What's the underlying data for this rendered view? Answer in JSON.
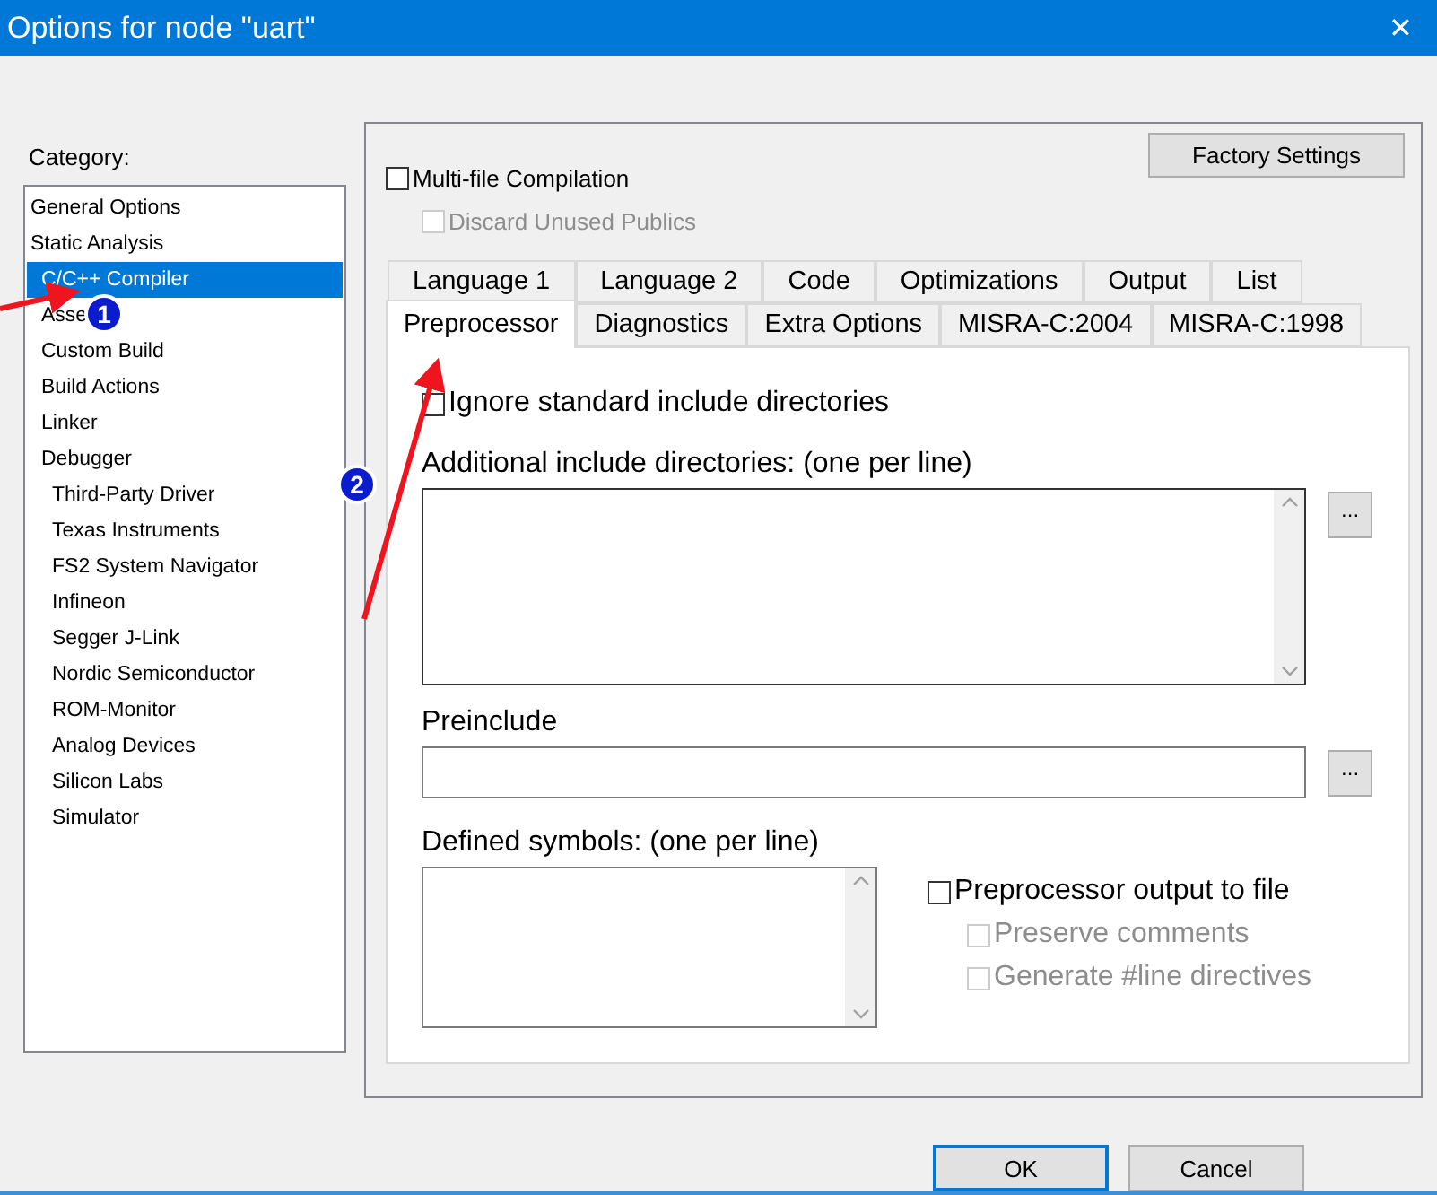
{
  "window": {
    "title": "Options for node \"uart\"",
    "close": "✕"
  },
  "category": {
    "label": "Category:",
    "items": [
      {
        "label": "General Options",
        "kind": "section",
        "selected": false
      },
      {
        "label": "Static Analysis",
        "kind": "section",
        "selected": false
      },
      {
        "label": "C/C++ Compiler",
        "kind": "tool",
        "selected": true
      },
      {
        "label": "Asse",
        "kind": "tool",
        "selected": false
      },
      {
        "label": "Custom Build",
        "kind": "tool",
        "selected": false
      },
      {
        "label": "Build Actions",
        "kind": "tool",
        "selected": false
      },
      {
        "label": "Linker",
        "kind": "tool",
        "selected": false
      },
      {
        "label": "Debugger",
        "kind": "tool",
        "selected": false,
        "children": [
          {
            "label": "Third-Party Driver",
            "kind": "tool",
            "selected": false
          },
          {
            "label": "Texas Instruments",
            "kind": "tool",
            "selected": false
          },
          {
            "label": "FS2 System Navigator",
            "kind": "tool",
            "selected": false
          },
          {
            "label": "Infineon",
            "kind": "tool",
            "selected": false
          },
          {
            "label": "Segger J-Link",
            "kind": "tool",
            "selected": false
          },
          {
            "label": "Nordic Semiconductor",
            "kind": "tool",
            "selected": false
          },
          {
            "label": "ROM-Monitor",
            "kind": "tool",
            "selected": false
          },
          {
            "label": "Analog Devices",
            "kind": "tool",
            "selected": false
          },
          {
            "label": "Silicon Labs",
            "kind": "tool",
            "selected": false
          },
          {
            "label": "Simulator",
            "kind": "tool",
            "selected": false
          }
        ]
      }
    ]
  },
  "factory_button": "Factory Settings",
  "options": [
    {
      "label": "Multi-file Compilation",
      "checked": false,
      "disabled": false
    },
    {
      "label": "Discard Unused Publics",
      "checked": false,
      "disabled": true
    }
  ],
  "tab_rows": [
    {
      "tabs": [
        {
          "label": "Language 1",
          "selected": false
        },
        {
          "label": "Language 2",
          "selected": false
        },
        {
          "label": "Code",
          "selected": false
        },
        {
          "label": "Optimizations",
          "selected": false
        },
        {
          "label": "Output",
          "selected": false
        },
        {
          "label": "List",
          "selected": false
        }
      ]
    },
    {
      "tabs": [
        {
          "label": "Preprocessor",
          "selected": true
        },
        {
          "label": "Diagnostics",
          "selected": false
        },
        {
          "label": "Extra Options",
          "selected": false
        },
        {
          "label": "MISRA-C:2004",
          "selected": false
        },
        {
          "label": "MISRA-C:1998",
          "selected": false
        }
      ]
    }
  ],
  "preprocessor": {
    "ignore_std": {
      "label": "Ignore standard include directories",
      "checked": false,
      "disabled": false
    },
    "include_dirs": {
      "label": "Additional include directories: (one per line)",
      "browse": "..."
    },
    "preinclude": {
      "label": "Preinclude",
      "browse": "..."
    },
    "defined_symbols": {
      "label": "Defined symbols: (one per line)"
    },
    "output_options": [
      {
        "label": "Preprocessor output to file",
        "checked": false,
        "disabled": false
      },
      {
        "label": "Preserve comments",
        "checked": false,
        "disabled": true
      },
      {
        "label": "Generate #line directives",
        "checked": false,
        "disabled": true
      }
    ]
  },
  "buttons": [
    {
      "label": "OK",
      "focused": true
    },
    {
      "label": "Cancel",
      "focused": false
    }
  ],
  "annotations": [
    {
      "label": "1"
    },
    {
      "label": "2"
    }
  ]
}
